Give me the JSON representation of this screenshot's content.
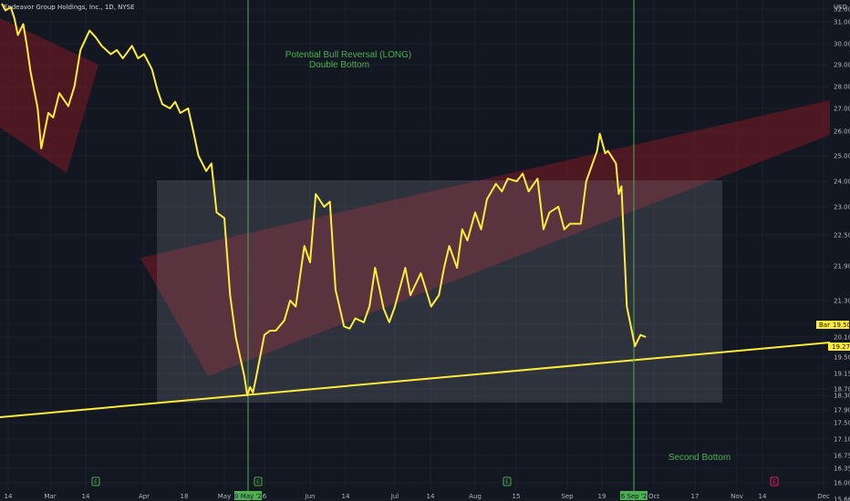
{
  "chart_data": {
    "type": "line",
    "title": "Endeavor Group Holdings, Inc., 1D, NYSE",
    "currency": "USD",
    "price_ticks": [
      "32.00",
      "31.00",
      "30.00",
      "29.00",
      "28.00",
      "27.00",
      "26.00",
      "25.00",
      "24.00",
      "23.00",
      "22.50",
      "21.90",
      "21.30",
      "20.70",
      "20.10",
      "19.50",
      "19.15",
      "18.70",
      "18.30",
      "17.90",
      "17.50",
      "17.10",
      "16.75",
      "16.35",
      "16.00",
      "15.66"
    ],
    "time_ticks": [
      "14",
      "Mar",
      "14",
      "Apr",
      "18",
      "May",
      "10 May '22",
      "6",
      "Jun",
      "14",
      "Jul",
      "14",
      "Aug",
      "15",
      "Sep",
      "19",
      "26 Sep '22",
      "Oct",
      "17",
      "Nov",
      "14",
      "Dec"
    ],
    "series": [
      {
        "name": "close",
        "color": "#ffeb3b",
        "points": [
          [
            "2022-02-02",
            32.6
          ],
          [
            "2022-02-04",
            31.9
          ],
          [
            "2022-02-07",
            32.2
          ],
          [
            "2022-02-09",
            31.3
          ],
          [
            "2022-02-11",
            30.4
          ],
          [
            "2022-02-14",
            30.9
          ],
          [
            "2022-02-16",
            29.9
          ],
          [
            "2022-02-18",
            28.7
          ],
          [
            "2022-02-22",
            27.0
          ],
          [
            "2022-02-24",
            25.3
          ],
          [
            "2022-02-28",
            26.8
          ],
          [
            "2022-03-02",
            26.6
          ],
          [
            "2022-03-04",
            27.7
          ],
          [
            "2022-03-07",
            27.1
          ],
          [
            "2022-03-09",
            28.0
          ],
          [
            "2022-03-11",
            29.7
          ],
          [
            "2022-03-14",
            30.6
          ],
          [
            "2022-03-16",
            30.3
          ],
          [
            "2022-03-18",
            29.9
          ],
          [
            "2022-03-21",
            29.5
          ],
          [
            "2022-03-23",
            29.7
          ],
          [
            "2022-03-25",
            29.3
          ],
          [
            "2022-03-28",
            29.9
          ],
          [
            "2022-03-30",
            29.3
          ],
          [
            "2022-04-01",
            29.5
          ],
          [
            "2022-04-04",
            28.8
          ],
          [
            "2022-04-06",
            27.9
          ],
          [
            "2022-04-08",
            27.2
          ],
          [
            "2022-04-11",
            27.0
          ],
          [
            "2022-04-13",
            27.3
          ],
          [
            "2022-04-15",
            26.8
          ],
          [
            "2022-04-18",
            27.0
          ],
          [
            "2022-04-20",
            26.0
          ],
          [
            "2022-04-22",
            25.0
          ],
          [
            "2022-04-25",
            24.4
          ],
          [
            "2022-04-27",
            24.7
          ],
          [
            "2022-04-29",
            22.9
          ],
          [
            "2022-05-02",
            22.8
          ],
          [
            "2022-05-04",
            21.4
          ],
          [
            "2022-05-06",
            19.5
          ],
          [
            "2022-05-09",
            18.6
          ],
          [
            "2022-05-10",
            17.9
          ],
          [
            "2022-05-11",
            18.2
          ],
          [
            "2022-05-12",
            18.0
          ],
          [
            "2022-05-13",
            18.5
          ],
          [
            "2022-05-16",
            19.6
          ],
          [
            "2022-05-18",
            19.8
          ],
          [
            "2022-05-20",
            19.8
          ],
          [
            "2022-05-23",
            20.3
          ],
          [
            "2022-05-25",
            21.3
          ],
          [
            "2022-05-27",
            21.0
          ],
          [
            "2022-05-30",
            22.3
          ],
          [
            "2022-06-01",
            22.0
          ],
          [
            "2022-06-03",
            23.5
          ],
          [
            "2022-06-06",
            23.0
          ],
          [
            "2022-06-08",
            23.2
          ],
          [
            "2022-06-10",
            21.5
          ],
          [
            "2022-06-13",
            20.0
          ],
          [
            "2022-06-15",
            19.9
          ],
          [
            "2022-06-17",
            20.4
          ],
          [
            "2022-06-20",
            20.2
          ],
          [
            "2022-06-22",
            21.0
          ],
          [
            "2022-06-24",
            21.9
          ],
          [
            "2022-06-27",
            20.9
          ],
          [
            "2022-06-29",
            20.2
          ],
          [
            "2022-07-01",
            21.0
          ],
          [
            "2022-07-05",
            21.9
          ],
          [
            "2022-07-07",
            21.4
          ],
          [
            "2022-07-11",
            21.8
          ],
          [
            "2022-07-13",
            21.5
          ],
          [
            "2022-07-15",
            21.0
          ],
          [
            "2022-07-18",
            21.4
          ],
          [
            "2022-07-20",
            21.9
          ],
          [
            "2022-07-22",
            22.3
          ],
          [
            "2022-07-25",
            21.9
          ],
          [
            "2022-07-27",
            22.6
          ],
          [
            "2022-07-29",
            22.4
          ],
          [
            "2022-08-01",
            22.9
          ],
          [
            "2022-08-03",
            22.6
          ],
          [
            "2022-08-05",
            23.3
          ],
          [
            "2022-08-08",
            23.9
          ],
          [
            "2022-08-10",
            23.6
          ],
          [
            "2022-08-12",
            24.1
          ],
          [
            "2022-08-15",
            24.0
          ],
          [
            "2022-08-17",
            24.3
          ],
          [
            "2022-08-19",
            23.6
          ],
          [
            "2022-08-22",
            24.1
          ],
          [
            "2022-08-24",
            22.6
          ],
          [
            "2022-08-26",
            22.9
          ],
          [
            "2022-08-29",
            23.0
          ],
          [
            "2022-08-31",
            22.6
          ],
          [
            "2022-09-02",
            22.7
          ],
          [
            "2022-09-06",
            22.7
          ],
          [
            "2022-09-08",
            24.0
          ],
          [
            "2022-09-12",
            25.2
          ],
          [
            "2022-09-13",
            25.9
          ],
          [
            "2022-09-15",
            25.1
          ],
          [
            "2022-09-16",
            25.2
          ],
          [
            "2022-09-19",
            24.7
          ],
          [
            "2022-09-20",
            23.5
          ],
          [
            "2022-09-21",
            23.8
          ],
          [
            "2022-09-23",
            21.0
          ],
          [
            "2022-09-26",
            19.3
          ],
          [
            "2022-09-28",
            19.6
          ],
          [
            "2022-09-30",
            19.5
          ]
        ]
      }
    ],
    "current_price": "19.27",
    "marker_price_label": "19.50",
    "marker_price_tag": "Bar",
    "vertical_markers": [
      "10 May '22",
      "26 Sep '22"
    ],
    "annotations": [
      "Potential Bull Reversal (LONG)",
      "Double Bottom",
      "Second Bottom"
    ],
    "colors": {
      "background": "#131722",
      "price_line": "#ffeb3b",
      "trendline": "#ffeb3b",
      "vertical_line": "#4caf50",
      "annotation_text": "#4caf50",
      "triangle_fill": "#801922",
      "box_fill": "#787b86",
      "axis_text": "#b2b5be",
      "grid": "#1e222d"
    },
    "grid": true,
    "event_markers": [
      "E",
      "E",
      "E",
      "E"
    ]
  }
}
